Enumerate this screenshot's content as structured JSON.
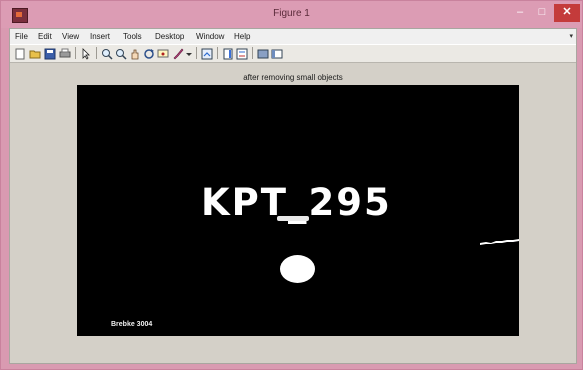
{
  "window": {
    "title": "Figure 1",
    "controls": {
      "minimize": "–",
      "maximize": "□",
      "close": "✕"
    }
  },
  "menubar": {
    "items": [
      "File",
      "Edit",
      "View",
      "Insert",
      "Tools",
      "Desktop",
      "Window",
      "Help"
    ],
    "overflow_arrow": "▾"
  },
  "toolbar": {
    "buttons": [
      "new-figure-icon",
      "open-file-icon",
      "save-icon",
      "print-icon",
      "edit-plot-arrow-icon",
      "zoom-in-icon",
      "zoom-out-icon",
      "pan-hand-icon",
      "rotate-3d-icon",
      "data-cursor-icon",
      "brush-icon",
      "brush-dropdown-icon",
      "link-plot-icon",
      "insert-colorbar-icon",
      "insert-legend-icon",
      "hide-plot-tools-icon",
      "show-plot-tools-icon"
    ]
  },
  "figure": {
    "axes_title": "after removing small objects",
    "plate_text": "KPT_295",
    "watermark": "Brebke 3004"
  },
  "colors": {
    "titlebar": "#dc9cb4",
    "close_button": "#c43b3b",
    "figure_background": "#d4d0c8",
    "image_background": "#000000",
    "image_foreground": "#ffffff"
  }
}
